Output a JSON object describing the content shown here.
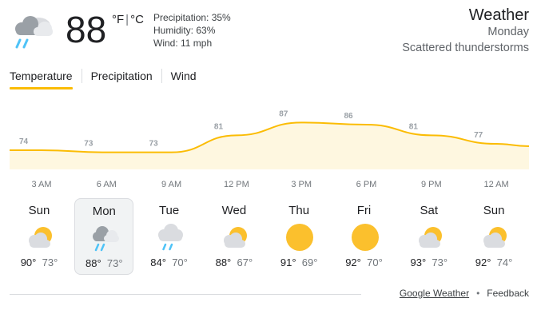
{
  "current": {
    "icon": "thunderstorm-rain-icon",
    "temp": "88",
    "unit_f": "°F",
    "unit_c": "°C",
    "precipitation": "Precipitation: 35%",
    "humidity": "Humidity: 63%",
    "wind": "Wind: 11 mph"
  },
  "header": {
    "title": "Weather",
    "day": "Monday",
    "condition": "Scattered thunderstorms"
  },
  "tabs": [
    {
      "label": "Temperature",
      "active": true
    },
    {
      "label": "Precipitation",
      "active": false
    },
    {
      "label": "Wind",
      "active": false
    }
  ],
  "chart_data": {
    "type": "area",
    "x": [
      "3 AM",
      "6 AM",
      "9 AM",
      "12 PM",
      "3 PM",
      "6 PM",
      "9 PM",
      "12 AM"
    ],
    "values": [
      74,
      73,
      73,
      81,
      87,
      86,
      81,
      77
    ],
    "fill_color": "#fef7e0",
    "line_color": "#fbbc04",
    "label_color": "#9aa0a6"
  },
  "days": [
    {
      "name": "Sun",
      "icon": "partly-cloudy-icon",
      "hi": "90°",
      "lo": "73°",
      "selected": false
    },
    {
      "name": "Mon",
      "icon": "thunderstorm-rain-icon",
      "hi": "88°",
      "lo": "73°",
      "selected": true
    },
    {
      "name": "Tue",
      "icon": "rain-cloud-icon",
      "hi": "84°",
      "lo": "70°",
      "selected": false
    },
    {
      "name": "Wed",
      "icon": "partly-cloudy-icon",
      "hi": "88°",
      "lo": "67°",
      "selected": false
    },
    {
      "name": "Thu",
      "icon": "sun-icon",
      "hi": "91°",
      "lo": "69°",
      "selected": false
    },
    {
      "name": "Fri",
      "icon": "sun-icon",
      "hi": "92°",
      "lo": "70°",
      "selected": false
    },
    {
      "name": "Sat",
      "icon": "partly-cloudy-icon",
      "hi": "93°",
      "lo": "73°",
      "selected": false
    },
    {
      "name": "Sun",
      "icon": "partly-cloudy-icon",
      "hi": "92°",
      "lo": "74°",
      "selected": false
    }
  ],
  "footer": {
    "source_link": "Google Weather",
    "feedback": "Feedback"
  }
}
